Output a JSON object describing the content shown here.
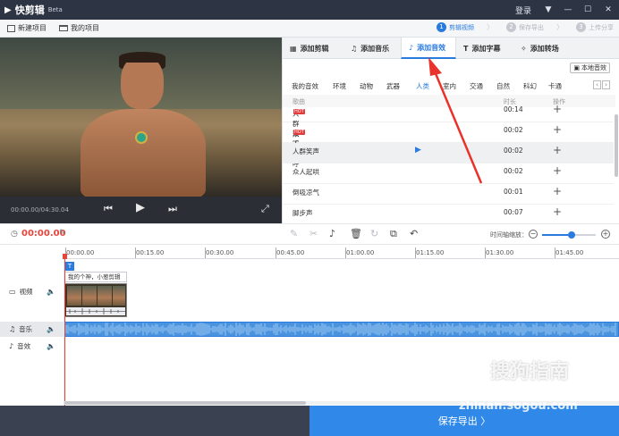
{
  "app": {
    "name": "快剪辑",
    "badge": "Beta"
  },
  "titlebar": {
    "login": "登录",
    "icons": [
      "dropdown-icon",
      "minimize-icon",
      "maximize-icon",
      "close-icon"
    ]
  },
  "menubar": {
    "new_project": "新建项目",
    "my_projects": "我的项目"
  },
  "steps": [
    {
      "num": "1",
      "label": "剪辑视频",
      "active": true
    },
    {
      "num": "2",
      "label": "保存导出",
      "active": false
    },
    {
      "num": "3",
      "label": "上传分享",
      "active": false
    }
  ],
  "player": {
    "time": "00:00.00/04:30.04"
  },
  "tabs": [
    {
      "label": "添加剪辑",
      "icon": "film-icon"
    },
    {
      "label": "添加音乐",
      "icon": "music-note-icon"
    },
    {
      "label": "添加音效",
      "icon": "sound-effect-icon",
      "active": true
    },
    {
      "label": "添加字幕",
      "icon": "text-icon"
    },
    {
      "label": "添加转场",
      "icon": "transition-icon"
    }
  ],
  "local_sfx": "本地音效",
  "categories": [
    "我的音效",
    "环境",
    "动物",
    "武器",
    "人类",
    "室内",
    "交通",
    "自然",
    "科幻",
    "卡通"
  ],
  "active_category": "人类",
  "table": {
    "col_song": "歌曲",
    "col_duration": "时长",
    "col_action": "操作"
  },
  "sfx": [
    {
      "name": "人群欢呼",
      "hot": "HOT",
      "duration": "00:14"
    },
    {
      "name": "众人欢呼",
      "hot": "HOT",
      "duration": "00:02"
    },
    {
      "name": "人群笑声",
      "hot": "",
      "duration": "00:02",
      "highlighted": true
    },
    {
      "name": "众人起哄",
      "hot": "",
      "duration": "00:02"
    },
    {
      "name": "倒吸凉气",
      "hot": "",
      "duration": "00:01"
    },
    {
      "name": "脚步声",
      "hot": "",
      "duration": "00:07"
    }
  ],
  "timeline": {
    "current_time": "00:00.00",
    "zoom_label": "时间轴缩放：",
    "zoom_level": 0.55,
    "ticks": [
      "00:00.00",
      "00:15.00",
      "00:30.00",
      "00:45.00",
      "01:00.00",
      "01:15.00",
      "01:30.00",
      "01:45.00"
    ],
    "tracks": [
      {
        "label": "视频",
        "icon": "video-icon"
      },
      {
        "label": "音乐",
        "icon": "music-note-icon"
      },
      {
        "label": "音效",
        "icon": "sound-effect-icon"
      }
    ],
    "text_clip": "我的个神，小葱剪辑",
    "text_badge": "T"
  },
  "footer": {
    "save_export": "保存导出 〉"
  },
  "watermark": {
    "brand": "搜狗指南",
    "url": "zhinan.sogou.com"
  },
  "colors": {
    "accent": "#2a7be0",
    "playhead": "#e5463c",
    "titlebar": "#2d3545",
    "save": "#3088e8"
  }
}
